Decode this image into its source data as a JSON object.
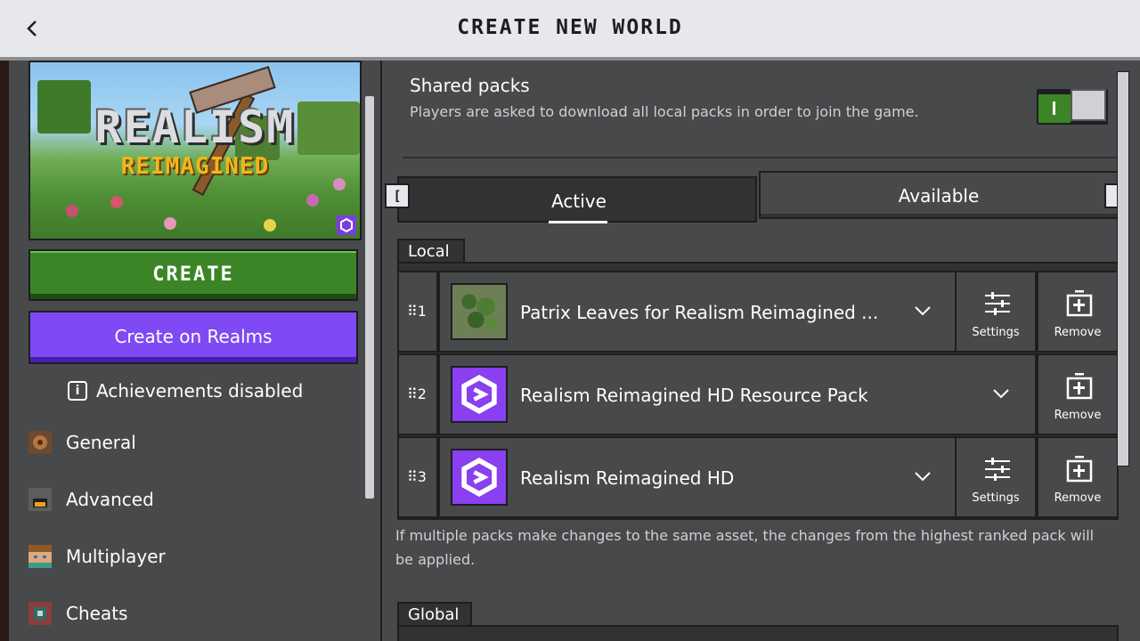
{
  "header": {
    "title": "CREATE NEW WORLD",
    "back_icon": "chevron-left-icon"
  },
  "world": {
    "logo_title": "REALISM",
    "logo_subtitle": "REIMAGINED",
    "create_label": "CREATE",
    "realms_label": "Create on Realms",
    "achievements_text": "Achievements disabled"
  },
  "nav": {
    "items": [
      {
        "label": "General",
        "icon": "gear-block-icon"
      },
      {
        "label": "Advanced",
        "icon": "furnace-icon"
      },
      {
        "label": "Multiplayer",
        "icon": "player-head-icon"
      },
      {
        "label": "Cheats",
        "icon": "command-block-icon"
      }
    ]
  },
  "shared": {
    "title": "Shared packs",
    "description": "Players are asked to download all local packs in order to join the game.",
    "enabled": true
  },
  "tabs": {
    "active_label": "Active",
    "available_label": "Available",
    "left_key": "[",
    "right_key": "]"
  },
  "local": {
    "label": "Local",
    "packs": [
      {
        "rank": "1",
        "name": "Patrix Leaves for Realism Reimagined ...",
        "icon": "leaves-icon",
        "has_settings": true
      },
      {
        "rank": "2",
        "name": "Realism Reimagined HD Resource Pack",
        "icon": "realms-logo-icon",
        "has_settings": false
      },
      {
        "rank": "3",
        "name": "Realism Reimagined HD",
        "icon": "realms-logo-icon",
        "has_settings": true
      }
    ],
    "settings_label": "Settings",
    "remove_label": "Remove",
    "note": "If multiple packs make changes to the same asset, the changes from the highest ranked pack will be applied."
  },
  "global": {
    "label": "Global"
  },
  "colors": {
    "create_green": "#3c8527",
    "realms_purple": "#7f4af3",
    "panel": "#48494a",
    "topbar": "#e6e8eb"
  }
}
